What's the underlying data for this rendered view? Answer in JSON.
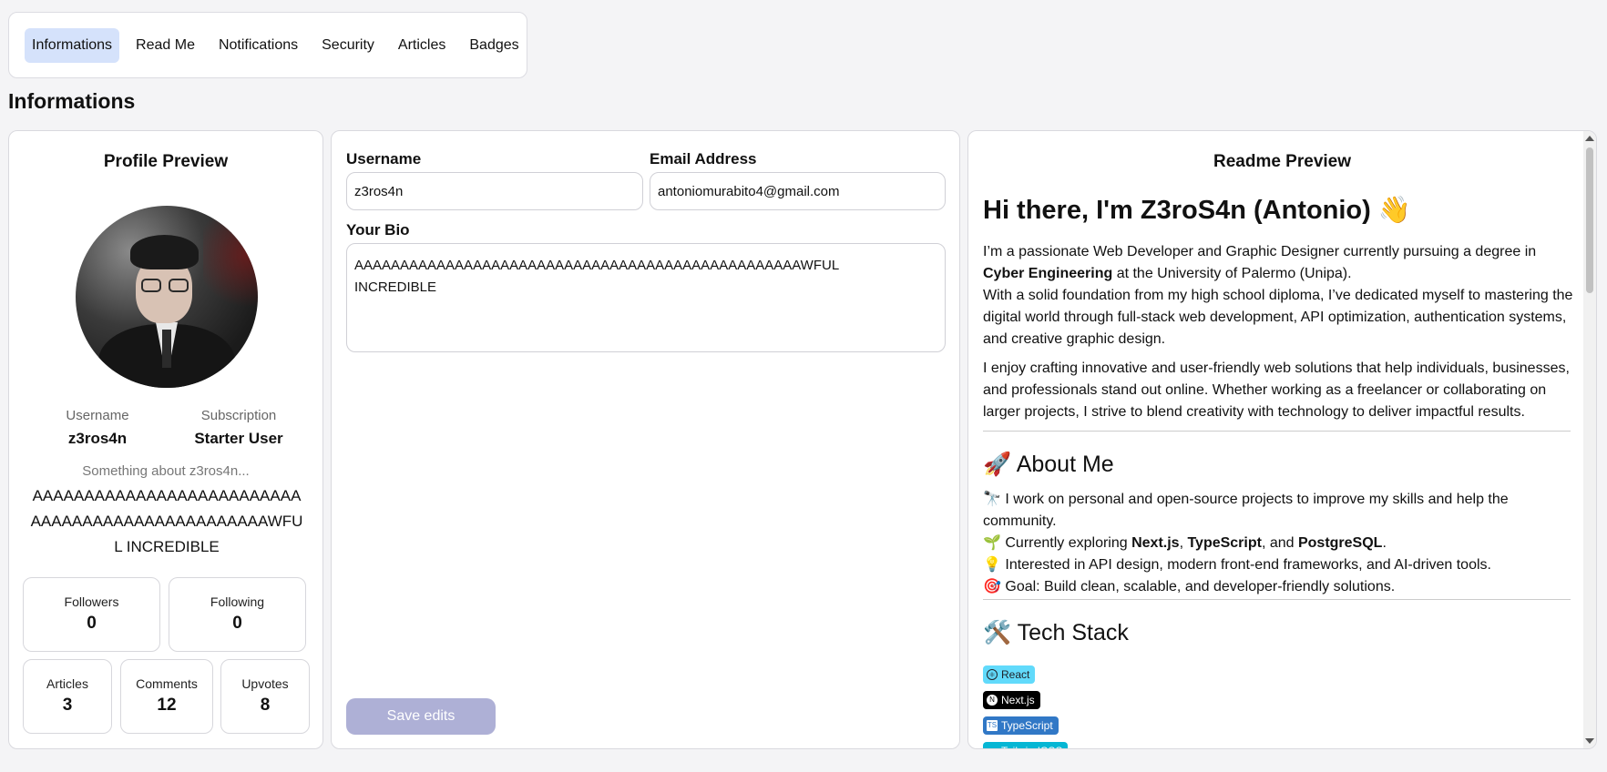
{
  "tabs": [
    {
      "label": "Informations",
      "active": true
    },
    {
      "label": "Read Me"
    },
    {
      "label": "Notifications"
    },
    {
      "label": "Security"
    },
    {
      "label": "Articles"
    },
    {
      "label": "Badges"
    }
  ],
  "page_title": "Informations",
  "profile": {
    "title": "Profile Preview",
    "username_label": "Username",
    "username": "z3ros4n",
    "subscription_label": "Subscription",
    "subscription": "Starter User",
    "about_label": "Something about z3ros4n...",
    "bio": "AAAAAAAAAAAAAAAAAAAAAAAAAAAAAAAAAAAAAAAAAAAAAAAAAWFUL INCREDIBLE",
    "stats": {
      "followers_label": "Followers",
      "followers": "0",
      "following_label": "Following",
      "following": "0",
      "articles_label": "Articles",
      "articles": "3",
      "comments_label": "Comments",
      "comments": "12",
      "upvotes_label": "Upvotes",
      "upvotes": "8"
    }
  },
  "form": {
    "username_label": "Username",
    "username_value": "z3ros4n",
    "email_label": "Email Address",
    "email_value": "antoniomurabito4@gmail.com",
    "bio_label": "Your Bio",
    "bio_value": "AAAAAAAAAAAAAAAAAAAAAAAAAAAAAAAAAAAAAAAAAAAAAAAAAWFUL\nINCREDIBLE",
    "save_label": "Save edits"
  },
  "readme": {
    "title": "Readme Preview",
    "heading": "Hi there, I'm Z3roS4n (Antonio) 👋",
    "p1_a": "I’m a passionate Web Developer and Graphic Designer currently pursuing a degree in ",
    "p1_bold": "Cyber Engineering",
    "p1_b": " at the University of Palermo (Unipa).",
    "p1_c": "With a solid foundation from my high school diploma, I’ve dedicated myself to mastering the digital world through full-stack web development, API optimization, authentication systems, and creative graphic design.",
    "p2": "I enjoy crafting innovative and user-friendly web solutions that help individuals, businesses, and professionals stand out online. Whether working as a freelancer or collaborating on larger projects, I strive to blend creativity with technology to deliver impactful results.",
    "about_heading": "🚀 About Me",
    "about_1": "🔭 I work on personal and open-source projects to improve my skills and help the community.",
    "about_2_a": "🌱 Currently exploring ",
    "about_2_b1": "Next.js",
    "about_2_sep1": ", ",
    "about_2_b2": "TypeScript",
    "about_2_sep2": ", and ",
    "about_2_b3": "PostgreSQL",
    "about_2_end": ".",
    "about_3": "💡 Interested in API design, modern front-end frameworks, and AI-driven tools.",
    "about_4": "🎯 Goal: Build clean, scalable, and developer-friendly solutions.",
    "tech_heading": "🛠️ Tech Stack",
    "badges": [
      {
        "label": "React",
        "color": "#61dafb",
        "icon_color": "#20232a"
      },
      {
        "label": "Next.js",
        "color": "#000000",
        "icon_color": "#ffffff"
      },
      {
        "label": "TypeScript",
        "color": "#3178c6",
        "icon_color": "#ffffff"
      },
      {
        "label": "TailwindCSS",
        "color": "#06b6d4",
        "icon_color": "#ffffff"
      }
    ]
  }
}
